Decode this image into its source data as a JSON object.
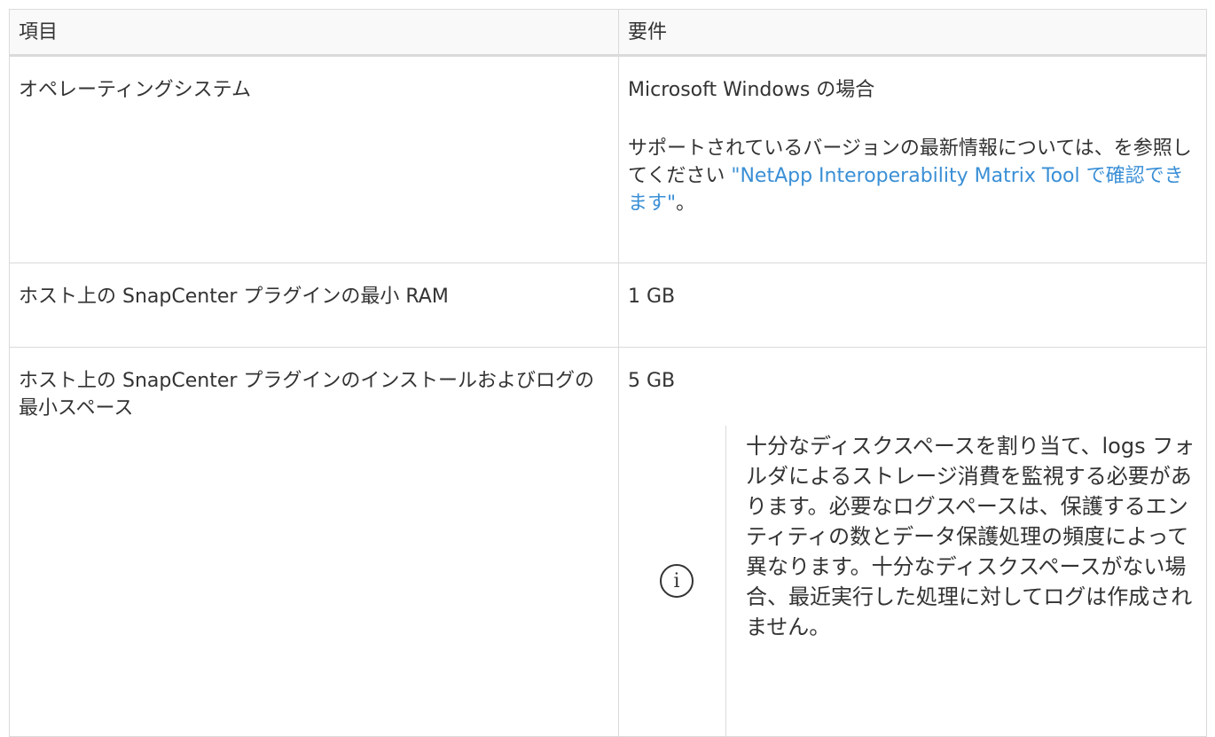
{
  "table": {
    "headers": {
      "item": "項目",
      "requirement": "要件"
    },
    "rows": {
      "os": {
        "item": "オペレーティングシステム",
        "req_line1": "Microsoft Windows の場合",
        "req_text": "サポートされているバージョンの最新情報については、を参照してください ",
        "req_link": "\"NetApp Interoperability Matrix Tool で確認できます\"",
        "req_suffix": "。"
      },
      "ram": {
        "item": "ホスト上の SnapCenter プラグインの最小 RAM",
        "req": "1 GB"
      },
      "space": {
        "item": "ホスト上の SnapCenter プラグインのインストールおよびログの最小スペース",
        "req": "5 GB",
        "note_icon": "info-icon",
        "note_text": "十分なディスクスペースを割り当て、logs フォルダによるストレージ消費を監視する必要があります。必要なログスペースは、保護するエンティティの数とデータ保護処理の頻度によって異なります。十分なディスクスペースがない場合、最近実行した処理に対してログは作成されません。"
      }
    }
  },
  "colors": {
    "link": "#3a8fd6",
    "text": "#333333",
    "border": "#dadada"
  }
}
